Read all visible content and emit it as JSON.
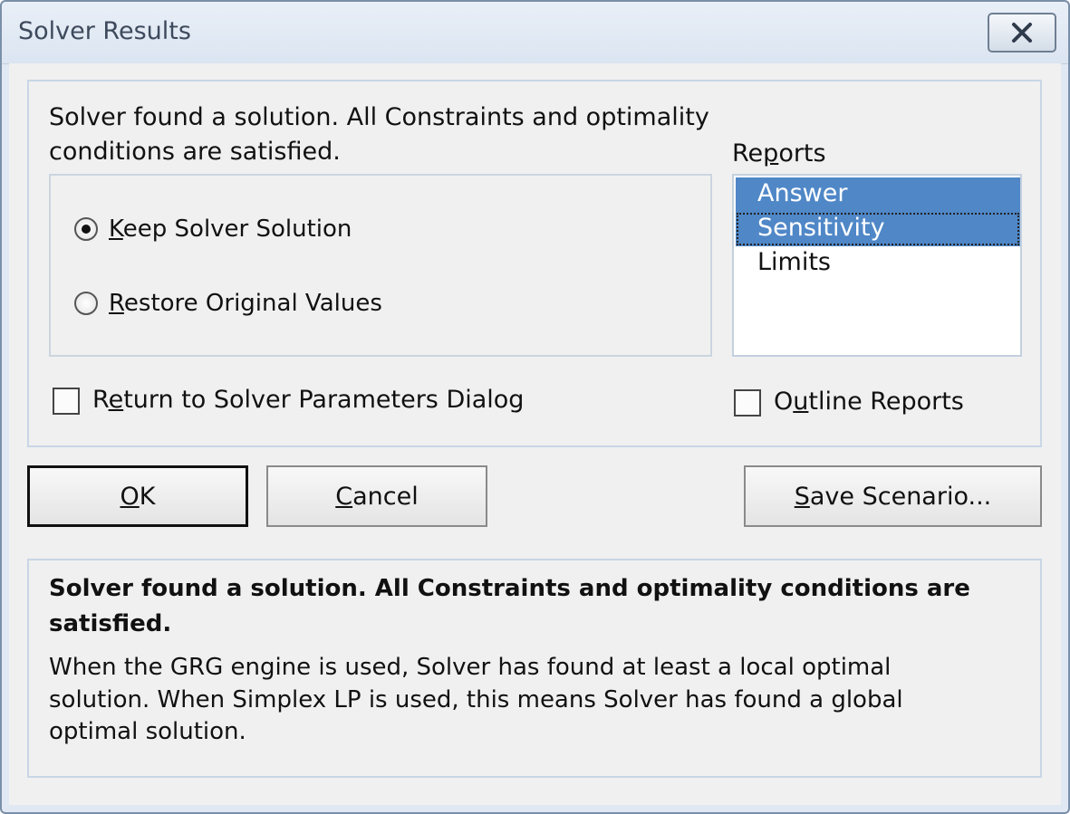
{
  "window": {
    "title": "Solver Results"
  },
  "message": {
    "line1": "Solver found a solution.  All Constraints and optimality",
    "line2": "conditions are satisfied."
  },
  "options": {
    "keep": {
      "mnemonic": "K",
      "rest": "eep Solver Solution",
      "selected": true
    },
    "restore": {
      "mnemonic": "R",
      "rest": "estore Original Values",
      "selected": false
    }
  },
  "reports": {
    "label_pre": "Re",
    "label_mnemonic": "p",
    "label_post": "orts",
    "items": [
      {
        "label": "Answer",
        "selected": true
      },
      {
        "label": "Sensitivity",
        "selected": true
      },
      {
        "label": "Limits",
        "selected": false
      }
    ]
  },
  "checkboxes": {
    "return_dialog": {
      "pre": "R",
      "mnemonic": "e",
      "post": "turn to Solver Parameters Dialog",
      "checked": false
    },
    "outline_reports": {
      "pre": "O",
      "mnemonic": "u",
      "post": "tline Reports",
      "checked": false
    }
  },
  "buttons": {
    "ok": {
      "mnemonic": "O",
      "rest": "K"
    },
    "cancel": {
      "mnemonic": "C",
      "rest": "ancel"
    },
    "save_scenario": {
      "mnemonic": "S",
      "rest": "ave Scenario..."
    }
  },
  "description": {
    "bold_line1": "Solver found a solution.  All Constraints and optimality conditions are",
    "bold_line2": "satisfied.",
    "line1": "When the GRG engine is used, Solver has found at least a local optimal",
    "line2": "solution. When Simplex LP is used, this means Solver has found a global",
    "line3": "optimal solution."
  },
  "colors": {
    "selection": "#4f87c7",
    "panel_border": "#c8d6e6",
    "dialog_bg": "#f0f0f0"
  }
}
